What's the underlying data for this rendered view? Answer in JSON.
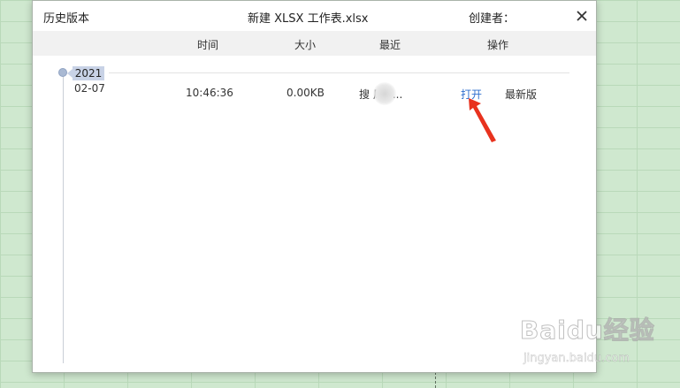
{
  "dialog": {
    "title": "历史版本",
    "file_name": "新建 XLSX 工作表.xlsx",
    "creator_label": "创建者："
  },
  "columns": {
    "time": "时间",
    "size": "大小",
    "recent": "最近",
    "action": "操作"
  },
  "timeline": {
    "year": "2021",
    "date": "02-07"
  },
  "version_row": {
    "time": "10:46:36",
    "size": "0.00KB",
    "recent": "搜 风~...",
    "open_label": "打开",
    "status": "最新版"
  },
  "icons": {
    "close": "close-icon",
    "arrow": "red-arrow-annotation"
  },
  "colors": {
    "link": "#2f6fcf",
    "annotation": "#e8321e",
    "year_tag": "#c8d2e6"
  },
  "watermark": {
    "main": "Baidu经验",
    "sub": "jingyan.baidu.com"
  }
}
